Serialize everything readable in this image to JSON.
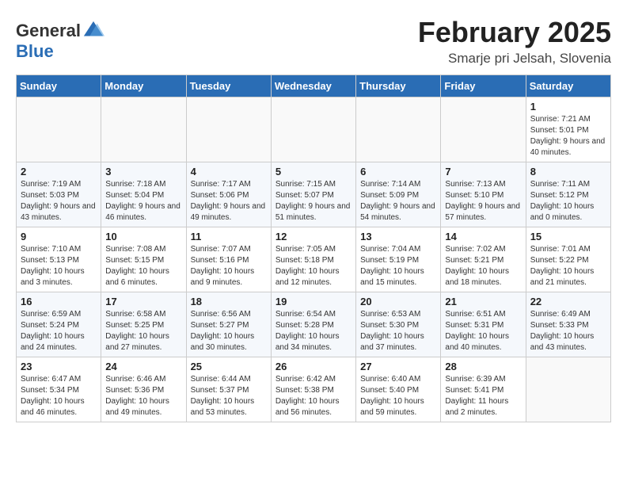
{
  "header": {
    "logo_general": "General",
    "logo_blue": "Blue",
    "month": "February 2025",
    "location": "Smarje pri Jelsah, Slovenia"
  },
  "weekdays": [
    "Sunday",
    "Monday",
    "Tuesday",
    "Wednesday",
    "Thursday",
    "Friday",
    "Saturday"
  ],
  "weeks": [
    [
      {
        "day": "",
        "info": ""
      },
      {
        "day": "",
        "info": ""
      },
      {
        "day": "",
        "info": ""
      },
      {
        "day": "",
        "info": ""
      },
      {
        "day": "",
        "info": ""
      },
      {
        "day": "",
        "info": ""
      },
      {
        "day": "1",
        "info": "Sunrise: 7:21 AM\nSunset: 5:01 PM\nDaylight: 9 hours and 40 minutes."
      }
    ],
    [
      {
        "day": "2",
        "info": "Sunrise: 7:19 AM\nSunset: 5:03 PM\nDaylight: 9 hours and 43 minutes."
      },
      {
        "day": "3",
        "info": "Sunrise: 7:18 AM\nSunset: 5:04 PM\nDaylight: 9 hours and 46 minutes."
      },
      {
        "day": "4",
        "info": "Sunrise: 7:17 AM\nSunset: 5:06 PM\nDaylight: 9 hours and 49 minutes."
      },
      {
        "day": "5",
        "info": "Sunrise: 7:15 AM\nSunset: 5:07 PM\nDaylight: 9 hours and 51 minutes."
      },
      {
        "day": "6",
        "info": "Sunrise: 7:14 AM\nSunset: 5:09 PM\nDaylight: 9 hours and 54 minutes."
      },
      {
        "day": "7",
        "info": "Sunrise: 7:13 AM\nSunset: 5:10 PM\nDaylight: 9 hours and 57 minutes."
      },
      {
        "day": "8",
        "info": "Sunrise: 7:11 AM\nSunset: 5:12 PM\nDaylight: 10 hours and 0 minutes."
      }
    ],
    [
      {
        "day": "9",
        "info": "Sunrise: 7:10 AM\nSunset: 5:13 PM\nDaylight: 10 hours and 3 minutes."
      },
      {
        "day": "10",
        "info": "Sunrise: 7:08 AM\nSunset: 5:15 PM\nDaylight: 10 hours and 6 minutes."
      },
      {
        "day": "11",
        "info": "Sunrise: 7:07 AM\nSunset: 5:16 PM\nDaylight: 10 hours and 9 minutes."
      },
      {
        "day": "12",
        "info": "Sunrise: 7:05 AM\nSunset: 5:18 PM\nDaylight: 10 hours and 12 minutes."
      },
      {
        "day": "13",
        "info": "Sunrise: 7:04 AM\nSunset: 5:19 PM\nDaylight: 10 hours and 15 minutes."
      },
      {
        "day": "14",
        "info": "Sunrise: 7:02 AM\nSunset: 5:21 PM\nDaylight: 10 hours and 18 minutes."
      },
      {
        "day": "15",
        "info": "Sunrise: 7:01 AM\nSunset: 5:22 PM\nDaylight: 10 hours and 21 minutes."
      }
    ],
    [
      {
        "day": "16",
        "info": "Sunrise: 6:59 AM\nSunset: 5:24 PM\nDaylight: 10 hours and 24 minutes."
      },
      {
        "day": "17",
        "info": "Sunrise: 6:58 AM\nSunset: 5:25 PM\nDaylight: 10 hours and 27 minutes."
      },
      {
        "day": "18",
        "info": "Sunrise: 6:56 AM\nSunset: 5:27 PM\nDaylight: 10 hours and 30 minutes."
      },
      {
        "day": "19",
        "info": "Sunrise: 6:54 AM\nSunset: 5:28 PM\nDaylight: 10 hours and 34 minutes."
      },
      {
        "day": "20",
        "info": "Sunrise: 6:53 AM\nSunset: 5:30 PM\nDaylight: 10 hours and 37 minutes."
      },
      {
        "day": "21",
        "info": "Sunrise: 6:51 AM\nSunset: 5:31 PM\nDaylight: 10 hours and 40 minutes."
      },
      {
        "day": "22",
        "info": "Sunrise: 6:49 AM\nSunset: 5:33 PM\nDaylight: 10 hours and 43 minutes."
      }
    ],
    [
      {
        "day": "23",
        "info": "Sunrise: 6:47 AM\nSunset: 5:34 PM\nDaylight: 10 hours and 46 minutes."
      },
      {
        "day": "24",
        "info": "Sunrise: 6:46 AM\nSunset: 5:36 PM\nDaylight: 10 hours and 49 minutes."
      },
      {
        "day": "25",
        "info": "Sunrise: 6:44 AM\nSunset: 5:37 PM\nDaylight: 10 hours and 53 minutes."
      },
      {
        "day": "26",
        "info": "Sunrise: 6:42 AM\nSunset: 5:38 PM\nDaylight: 10 hours and 56 minutes."
      },
      {
        "day": "27",
        "info": "Sunrise: 6:40 AM\nSunset: 5:40 PM\nDaylight: 10 hours and 59 minutes."
      },
      {
        "day": "28",
        "info": "Sunrise: 6:39 AM\nSunset: 5:41 PM\nDaylight: 11 hours and 2 minutes."
      },
      {
        "day": "",
        "info": ""
      }
    ]
  ]
}
